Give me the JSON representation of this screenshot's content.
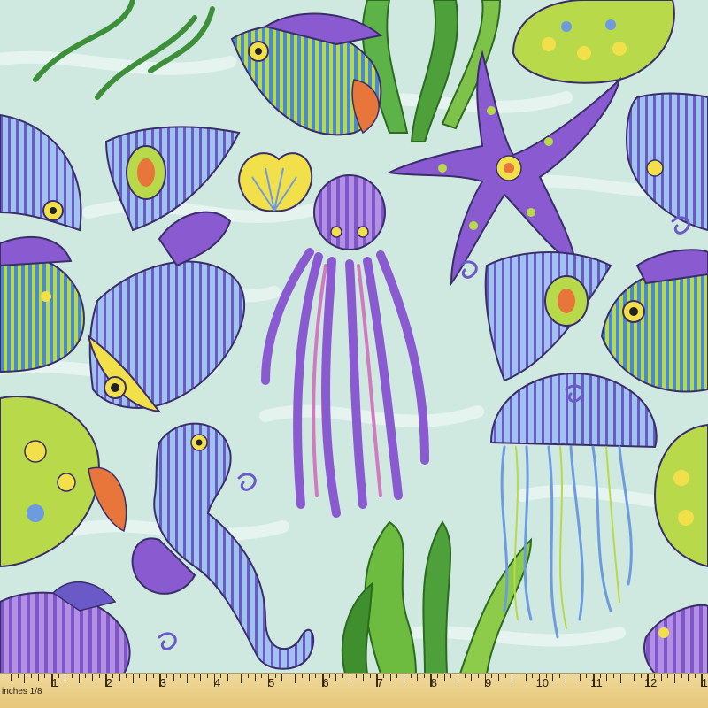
{
  "image": {
    "subject": "ocean-life-print-fabric",
    "colors": {
      "background": "#cfe9e1",
      "wave": "#e8f5f1",
      "purple": "#8a5bd0",
      "violet": "#6a5ac8",
      "blue": "#6d9be0",
      "lime": "#b7d94a",
      "green": "#4ea13a",
      "yellow": "#f2e04a",
      "orange": "#e8763a",
      "pink": "#d07ac0"
    }
  },
  "ruler": {
    "unit_label": "inches 1/8",
    "numbers": [
      "1",
      "2",
      "3",
      "4",
      "5",
      "6",
      "7",
      "8",
      "9",
      "10",
      "11",
      "12",
      "1"
    ]
  }
}
